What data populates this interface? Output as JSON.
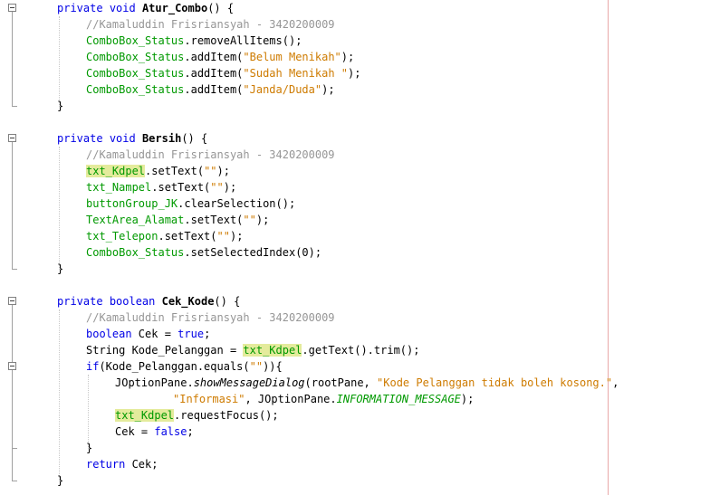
{
  "editor": {
    "method1": {
      "signature": {
        "kw1": "private",
        "kw2": "void",
        "name": "Atur_Combo",
        "rest": "() {"
      },
      "comment": "//Kamaluddin Frisriansyah - 3420200009",
      "l1": {
        "obj": "ComboBox_Status",
        "call": ".removeAllItems();"
      },
      "l2": {
        "obj": "ComboBox_Status",
        "call1": ".addItem(",
        "str": "\"Belum Menikah\"",
        "end": ");"
      },
      "l3": {
        "obj": "ComboBox_Status",
        "call1": ".addItem(",
        "str": "\"Sudah Menikah \"",
        "end": ");"
      },
      "l4": {
        "obj": "ComboBox_Status",
        "call1": ".addItem(",
        "str": "\"Janda/Duda\"",
        "end": ");"
      },
      "close": "}"
    },
    "method2": {
      "signature": {
        "kw1": "private",
        "kw2": "void",
        "name": "Bersih",
        "rest": "() {"
      },
      "comment": "//Kamaluddin Frisriansyah - 3420200009",
      "l1": {
        "obj": "txt_Kdpel",
        "call1": ".setText(",
        "str": "\"\"",
        "end": ");"
      },
      "l2": {
        "obj": "txt_Nampel",
        "call1": ".setText(",
        "str": "\"\"",
        "end": ");"
      },
      "l3": {
        "obj": "buttonGroup_JK",
        "call": ".clearSelection();"
      },
      "l4": {
        "obj": "TextArea_Alamat",
        "call1": ".setText(",
        "str": "\"\"",
        "end": ");"
      },
      "l5": {
        "obj": "txt_Telepon",
        "call1": ".setText(",
        "str": "\"\"",
        "end": ");"
      },
      "l6": {
        "obj": "ComboBox_Status",
        "call": ".setSelectedIndex(0);"
      },
      "close": "}"
    },
    "method3": {
      "signature": {
        "kw1": "private",
        "kw2": "boolean",
        "name": "Cek_Kode",
        "rest": "() {"
      },
      "comment": "//Kamaluddin Frisriansyah - 3420200009",
      "l1": {
        "kw": "boolean",
        "mid": " Cek = ",
        "val": "true",
        "end": ";"
      },
      "l2": {
        "pre": "String Kode_Pelanggan = ",
        "obj": "txt_Kdpel",
        "end": ".getText().trim();"
      },
      "l3": {
        "kw": "if",
        "mid": "(Kode_Pelanggan.equals(",
        "str": "\"\"",
        "end": ")){"
      },
      "l4": {
        "pre": "JOptionPane.",
        "method": "showMessageDialog",
        "mid": "(rootPane, ",
        "str": "\"Kode Pelanggan tidak boleh kosong.\"",
        "end": ","
      },
      "l5": {
        "str": "\"Informasi\"",
        "mid": ", JOptionPane.",
        "const": "INFORMATION_MESSAGE",
        "end": ");"
      },
      "l6": {
        "obj": "txt_Kdpel",
        "end": ".requestFocus();"
      },
      "l7": {
        "pre": "Cek = ",
        "val": "false",
        "end": ";"
      },
      "l8": "}",
      "l9": {
        "kw": "return",
        "end": " Cek;"
      },
      "close": "}"
    }
  }
}
